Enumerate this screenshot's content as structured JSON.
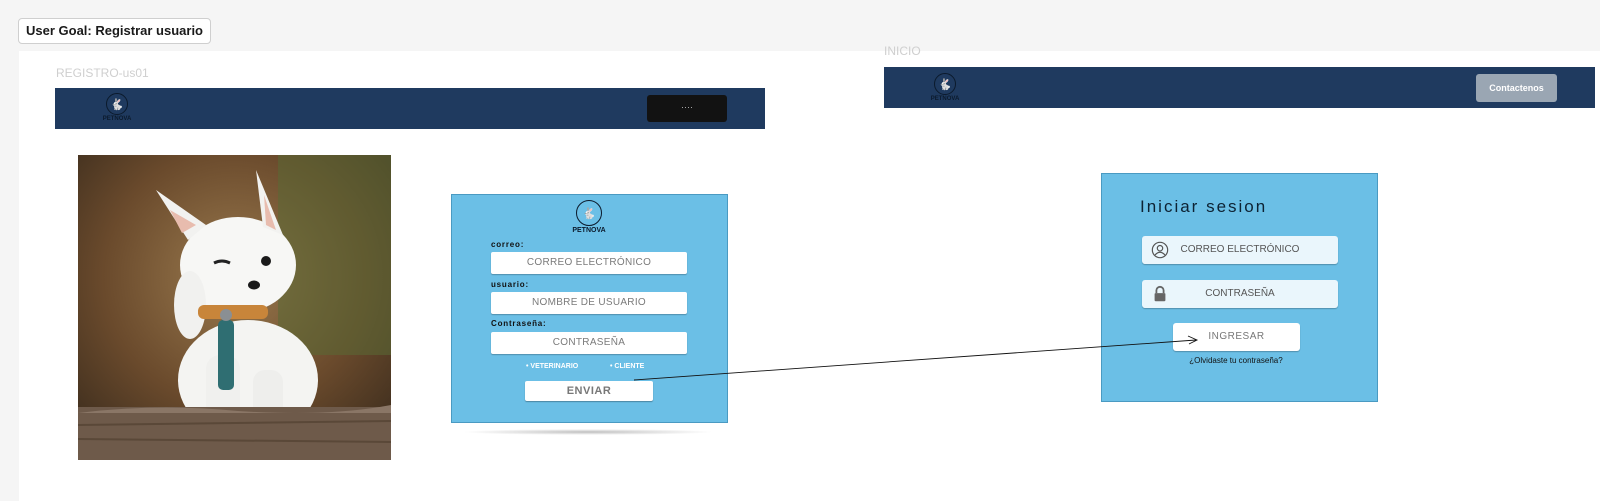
{
  "goal": {
    "label": "User Goal: Registrar usuario"
  },
  "frames": {
    "registro": {
      "label": "REGISTRO-us01"
    },
    "inicio": {
      "label": "INICIO"
    }
  },
  "brand": {
    "name": "PETNOVA"
  },
  "registro_nav": {
    "button_label": "····"
  },
  "inicio_nav": {
    "button_label": "Contactenos"
  },
  "register_form": {
    "brand": "PETNOVA",
    "email_label": "correo:",
    "email_placeholder": "CORREO ELECTRÓNICO",
    "user_label": "usuario:",
    "user_placeholder": "NOMBRE DE USUARIO",
    "password_label": "Contraseña:",
    "password_placeholder": "CONTRASEÑA",
    "role_options": [
      "• VETERINARIO",
      "• CLIENTE"
    ],
    "submit_label": "ENVIAR"
  },
  "login_form": {
    "title": "Iniciar sesion",
    "email_placeholder": "CORREO ELECTRÓNICO",
    "password_placeholder": "CONTRASEÑA",
    "submit_label": "INGRESAR",
    "forgot_link": "¿Olvidaste tu contraseña?"
  },
  "icons": {
    "logo": "rabbit-logo-icon",
    "user": "user-circle-icon",
    "lock": "lock-icon",
    "arrow": "arrow-connector-icon"
  },
  "colors": {
    "navbar": "#1f3a5f",
    "card": "#6bbfe6",
    "contact_button": "#9aa6b3"
  }
}
